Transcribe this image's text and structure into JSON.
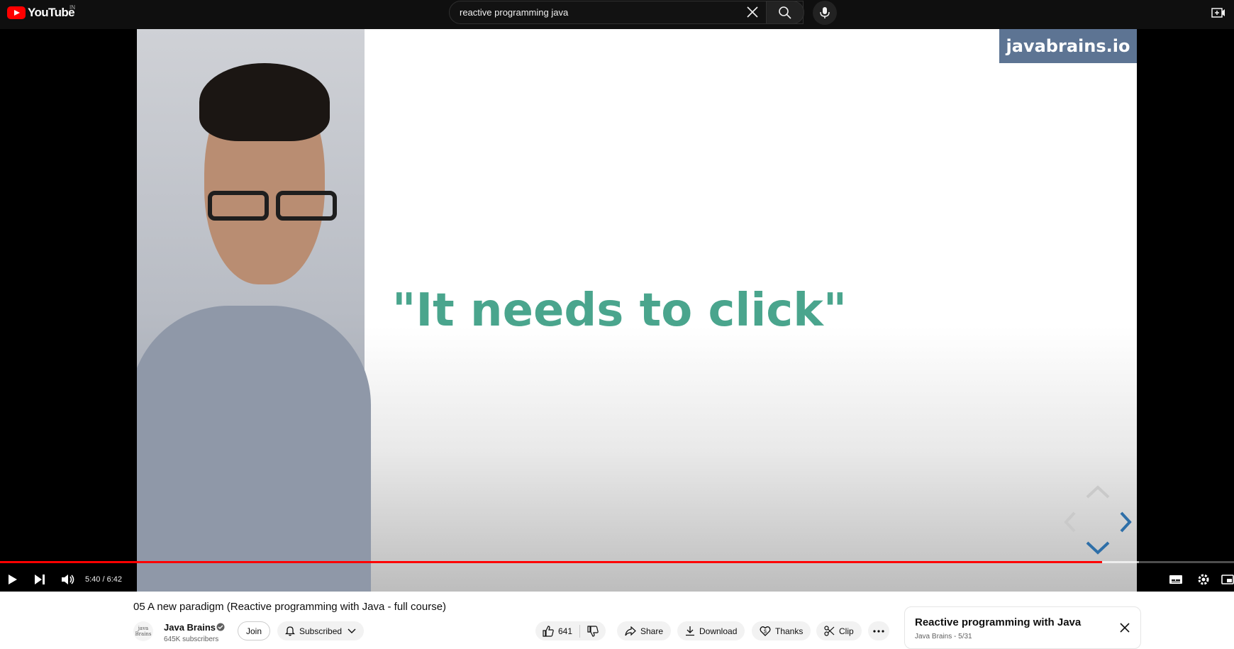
{
  "masthead": {
    "logo_text": "YouTube",
    "country": "IN",
    "search_value": "reactive programming java"
  },
  "video": {
    "slide_text": "\"It needs to click\"",
    "watermark": "javabrains.io"
  },
  "player": {
    "time": "5:40 / 6:42",
    "progress_fraction": 0.893,
    "buffer_fraction": 0.923
  },
  "meta": {
    "title": "05 A new paradigm (Reactive programming with Java - full course)",
    "channel_name": "Java Brains",
    "subscribers": "645K subscribers",
    "avatar_text": "java Brains",
    "join_label": "Join",
    "subscribed_label": "Subscribed",
    "like_count": "641",
    "share_label": "Share",
    "download_label": "Download",
    "thanks_label": "Thanks",
    "clip_label": "Clip"
  },
  "playlist": {
    "title": "Reactive programming with Java",
    "subtitle": "Java Brains - 5/31"
  },
  "colors": {
    "brand_red": "#ff0000",
    "slide_green": "#4aa58d",
    "watermark_bg": "#5d7493"
  }
}
